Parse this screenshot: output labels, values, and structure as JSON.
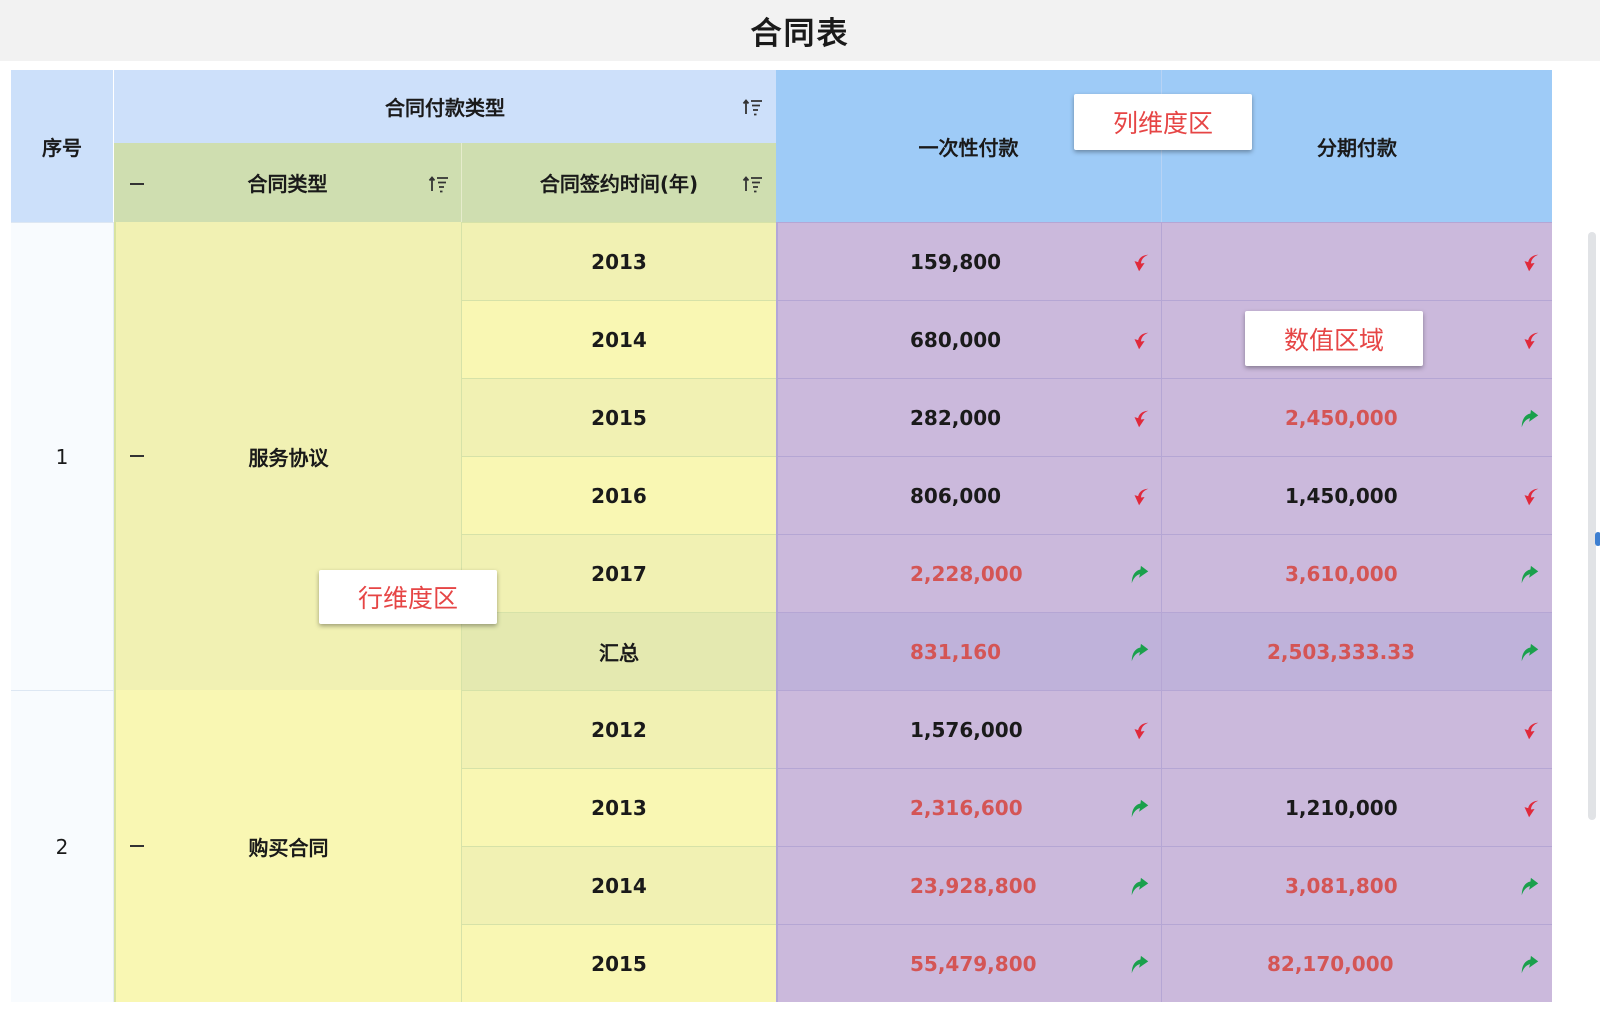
{
  "title": "合同表",
  "header": {
    "seq_label": "序号",
    "payment_type_label": "合同付款类型",
    "contract_type_label": "合同类型",
    "sign_year_label": "合同签约时间(年)",
    "col_one_time": "一次性付款",
    "col_installment": "分期付款"
  },
  "groups": [
    {
      "seq": "1",
      "type": "服务协议",
      "rows": [
        {
          "year": "2013",
          "one_time": "159,800",
          "one_time_trend": "down",
          "installment": "",
          "installment_trend": "down"
        },
        {
          "year": "2014",
          "one_time": "680,000",
          "one_time_trend": "down",
          "installment": "",
          "installment_trend": "down"
        },
        {
          "year": "2015",
          "one_time": "282,000",
          "one_time_trend": "down",
          "installment": "2,450,000",
          "installment_trend": "up"
        },
        {
          "year": "2016",
          "one_time": "806,000",
          "one_time_trend": "down",
          "installment": "1,450,000",
          "installment_trend": "down"
        },
        {
          "year": "2017",
          "one_time": "2,228,000",
          "one_time_trend": "up",
          "installment": "3,610,000",
          "installment_trend": "up"
        },
        {
          "year": "汇总",
          "one_time": "831,160",
          "one_time_trend": "up",
          "installment": "2,503,333.33",
          "installment_trend": "up"
        }
      ]
    },
    {
      "seq": "2",
      "type": "购买合同",
      "rows": [
        {
          "year": "2012",
          "one_time": "1,576,000",
          "one_time_trend": "down",
          "installment": "",
          "installment_trend": "down"
        },
        {
          "year": "2013",
          "one_time": "2,316,600",
          "one_time_trend": "up",
          "installment": "1,210,000",
          "installment_trend": "down"
        },
        {
          "year": "2014",
          "one_time": "23,928,800",
          "one_time_trend": "up",
          "installment": "3,081,800",
          "installment_trend": "up"
        },
        {
          "year": "2015",
          "one_time": "55,479,800",
          "one_time_trend": "up",
          "installment": "82,170,000",
          "installment_trend": "up"
        }
      ]
    }
  ],
  "callouts": {
    "column_dim": "列维度区",
    "value_area": "数值区域",
    "row_dim": "行维度区"
  },
  "colors": {
    "seq_header_bg": "#cce0fa",
    "payment_header_bg": "#cde0fa",
    "row_dim_header_bg": "#cfdeb0",
    "col_header_bg": "#9ecbf7",
    "value_bg": "#cbb9dc",
    "value_summary_bg": "#bfb2da",
    "year_bg_a": "#f1f1b3",
    "year_bg_b": "#f9f7b3",
    "year_summary_bg": "#e4e9b0",
    "trend_up": "#1aa04c",
    "trend_down": "#e02a3c",
    "highlight_text": "#d45555"
  },
  "icons": [
    "sort-icon",
    "minus-icon",
    "trend-up-icon",
    "trend-down-icon"
  ]
}
